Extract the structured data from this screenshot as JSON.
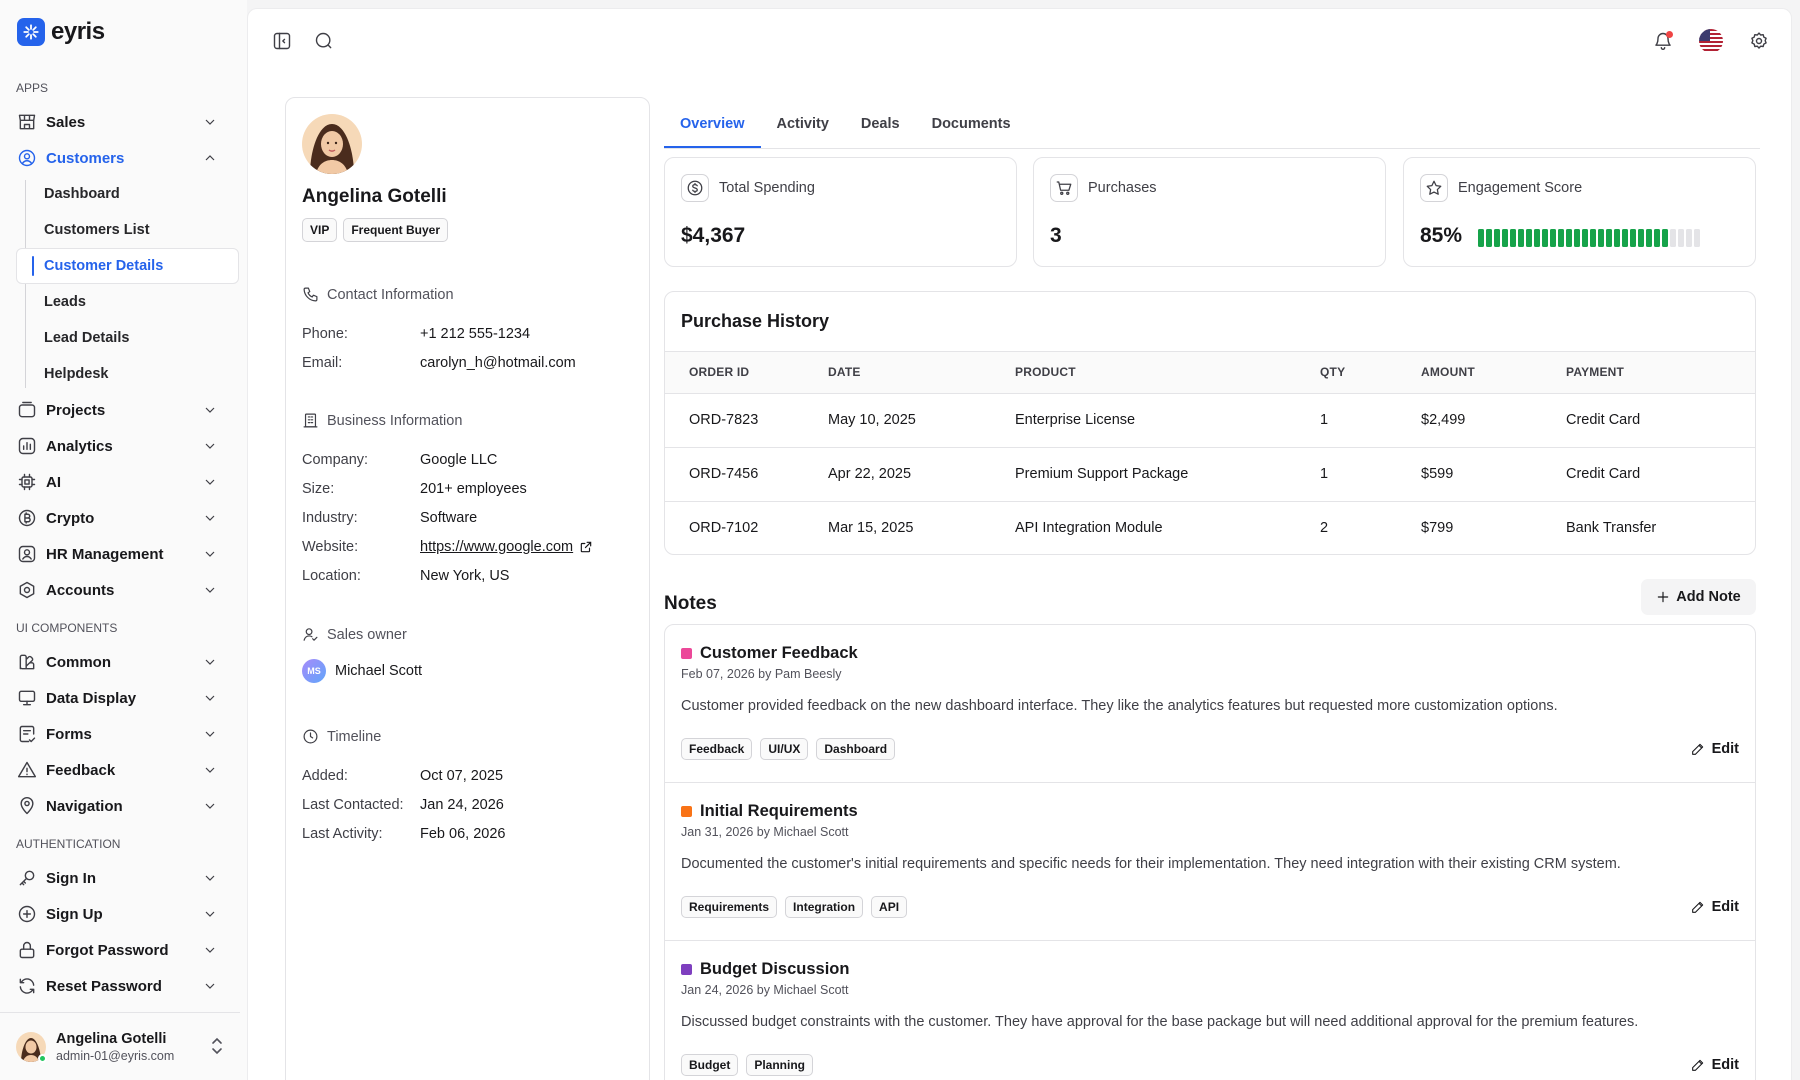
{
  "brand": {
    "name": "eyris",
    "color": "#2563eb"
  },
  "sidebar": {
    "sections": {
      "apps": "APPS",
      "ui_components": "UI COMPONENTS",
      "authentication": "AUTHENTICATION"
    },
    "items": {
      "sales": "Sales",
      "customers": "Customers",
      "projects": "Projects",
      "analytics": "Analytics",
      "ai": "AI",
      "crypto": "Crypto",
      "hr_management": "HR Management",
      "accounts": "Accounts",
      "common": "Common",
      "data_display": "Data Display",
      "forms": "Forms",
      "feedback": "Feedback",
      "navigation": "Navigation",
      "sign_in": "Sign In",
      "sign_up": "Sign Up",
      "forgot_password": "Forgot Password",
      "reset_password": "Reset Password"
    },
    "customers_sub": {
      "dashboard": "Dashboard",
      "customers_list": "Customers List",
      "customer_details": "Customer Details",
      "leads": "Leads",
      "lead_details": "Lead Details",
      "helpdesk": "Helpdesk"
    },
    "user": {
      "name": "Angelina Gotelli",
      "email": "admin-01@eyris.com"
    }
  },
  "profile": {
    "name": "Angelina Gotelli",
    "tags": [
      "VIP",
      "Frequent Buyer"
    ],
    "contact": {
      "title": "Contact Information",
      "phone_label": "Phone:",
      "phone": "+1 212 555-1234",
      "email_label": "Email:",
      "email": "carolyn_h@hotmail.com"
    },
    "business": {
      "title": "Business Information",
      "company_label": "Company:",
      "company": "Google LLC",
      "size_label": "Size:",
      "size": "201+ employees",
      "industry_label": "Industry:",
      "industry": "Software",
      "website_label": "Website:",
      "website": "https://www.google.com",
      "location_label": "Location:",
      "location": "New York, US"
    },
    "owner": {
      "title": "Sales owner",
      "initials": "MS",
      "name": "Michael Scott"
    },
    "timeline": {
      "title": "Timeline",
      "added_label": "Added:",
      "added": "Oct 07, 2025",
      "contacted_label": "Last Contacted:",
      "contacted": "Jan 24, 2026",
      "activity_label": "Last Activity:",
      "activity": "Feb 06, 2026"
    }
  },
  "tabs": [
    "Overview",
    "Activity",
    "Deals",
    "Documents"
  ],
  "stats": {
    "spending": {
      "label": "Total Spending",
      "value": "$4,367"
    },
    "purchases": {
      "label": "Purchases",
      "value": "3"
    },
    "engagement": {
      "label": "Engagement Score",
      "value": "85%",
      "fraction": 0.85,
      "color": "#16a34a"
    }
  },
  "purchase_history": {
    "title": "Purchase History",
    "columns": [
      "ORDER ID",
      "DATE",
      "PRODUCT",
      "QTY",
      "AMOUNT",
      "PAYMENT"
    ],
    "rows": [
      [
        "ORD-7823",
        "May 10, 2025",
        "Enterprise License",
        "1",
        "$2,499",
        "Credit Card"
      ],
      [
        "ORD-7456",
        "Apr 22, 2025",
        "Premium Support Package",
        "1",
        "$599",
        "Credit Card"
      ],
      [
        "ORD-7102",
        "Mar 15, 2025",
        "API Integration Module",
        "2",
        "$799",
        "Bank Transfer"
      ]
    ]
  },
  "notes": {
    "title": "Notes",
    "add_label": "Add Note",
    "edit_label": "Edit",
    "items": [
      {
        "title": "Customer Feedback",
        "color": "#ec4899",
        "meta": "Feb 07, 2026 by Pam Beesly",
        "body": "Customer provided feedback on the new dashboard interface. They like the analytics features but requested more customization options.",
        "tags": [
          "Feedback",
          "UI/UX",
          "Dashboard"
        ]
      },
      {
        "title": "Initial Requirements",
        "color": "#f97316",
        "meta": "Jan 31, 2026 by Michael Scott",
        "body": "Documented the customer's initial requirements and specific needs for their implementation. They need integration with their existing CRM system.",
        "tags": [
          "Requirements",
          "Integration",
          "API"
        ]
      },
      {
        "title": "Budget Discussion",
        "color": "#7e3fbf",
        "meta": "Jan 24, 2026 by Michael Scott",
        "body": "Discussed budget constraints with the customer. They have approval for the base package but will need additional approval for the premium features.",
        "tags": [
          "Budget",
          "Planning"
        ]
      }
    ]
  }
}
